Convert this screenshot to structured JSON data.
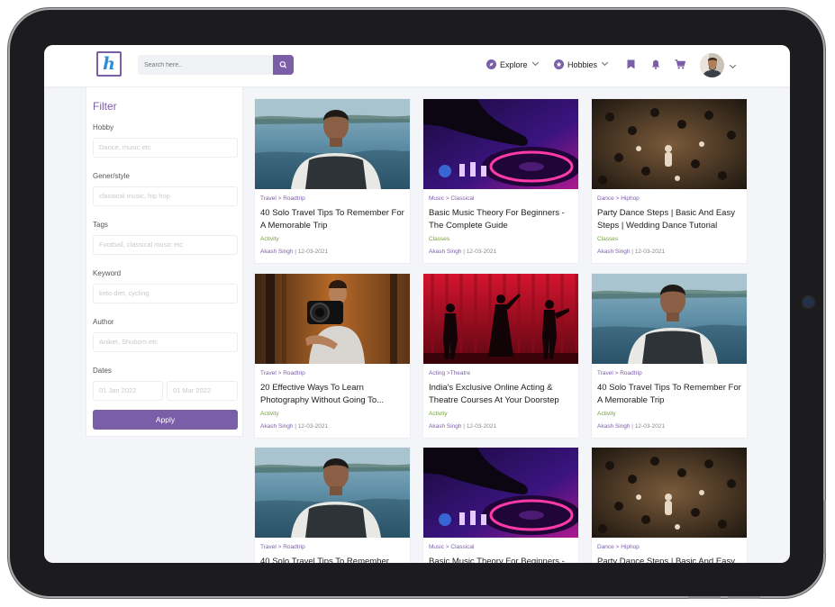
{
  "logo": {
    "letter": "h"
  },
  "search": {
    "placeholder": "Search here..",
    "icon": "search-icon"
  },
  "nav": {
    "explore_label": "Explore",
    "hobbies_label": "Hobbies",
    "icons": [
      "compass-icon",
      "star-icon",
      "bookmark-icon",
      "bell-icon",
      "cart-icon",
      "avatar",
      "chevron-down-icon"
    ]
  },
  "filter": {
    "title": "Filter",
    "hobby_label": "Hobby",
    "hobby_placeholder": "Dance, music etc",
    "genre_label": "Gener/style",
    "genre_placeholder": "classical music, hip hop",
    "tags_label": "Tags",
    "tags_placeholder": "Football, classical music etc",
    "keyword_label": "Keyword",
    "keyword_placeholder": "keto diet, cycling",
    "author_label": "Author",
    "author_placeholder": "Aniket, Shubom etc",
    "dates_label": "Dates",
    "date_from": "01 Jan 2022",
    "date_to": "01 Mar 2022",
    "apply_label": "Apply"
  },
  "colors": {
    "accent": "#7a5ea8",
    "type": "#75a33a",
    "bg": "#f4f5f9"
  },
  "cards": [
    {
      "category": "Travel > Roadtrip",
      "title": "40 Solo Travel Tips To Remember For A Memorable Trip",
      "type": "Activity",
      "author": "Akash Singh",
      "date": "12-03-2021",
      "image": "lake-backpacker"
    },
    {
      "category": "Music > Classical",
      "title": "Basic Music Theory For Beginners - The Complete Guide",
      "type": "Classes",
      "author": "Akash Singh",
      "date": "12-03-2021",
      "image": "dj-turntable"
    },
    {
      "category": "Dance > Hiphop",
      "title": "Party Dance Steps | Basic And Easy Steps | Wedding Dance Tutorial",
      "type": "Classes",
      "author": "Akash Singh",
      "date": "12-03-2021",
      "image": "dance-crowd"
    },
    {
      "category": "Travel > Roadtrip",
      "title": "20 Effective Ways To Learn Photography Without Going To...",
      "type": "Activity",
      "author": "Akash Singh",
      "date": "12-03-2021",
      "image": "photographer-forest"
    },
    {
      "category": "Acting >Theatre",
      "title": "India's Exclusive Online Acting & Theatre Courses At Your Doorstep",
      "type": "Activity",
      "author": "Akash Singh",
      "date": "12-03-2021",
      "image": "theatre-stage"
    },
    {
      "category": "Travel > Roadtrip",
      "title": "40 Solo Travel Tips To Remember For A Memorable Trip",
      "type": "Activity",
      "author": "Akash Singh",
      "date": "12-03-2021",
      "image": "lake-backpacker"
    },
    {
      "category": "Travel > Roadtrip",
      "title": "40 Solo Travel Tips To Remember",
      "type": "",
      "author": "",
      "date": "",
      "image": "lake-backpacker"
    },
    {
      "category": "Music > Classical",
      "title": "Basic Music Theory For Beginners -",
      "type": "",
      "author": "",
      "date": "",
      "image": "dj-turntable"
    },
    {
      "category": "Dance > Hiphop",
      "title": "Party Dance Steps | Basic And Easy",
      "type": "",
      "author": "",
      "date": "",
      "image": "dance-crowd"
    }
  ]
}
